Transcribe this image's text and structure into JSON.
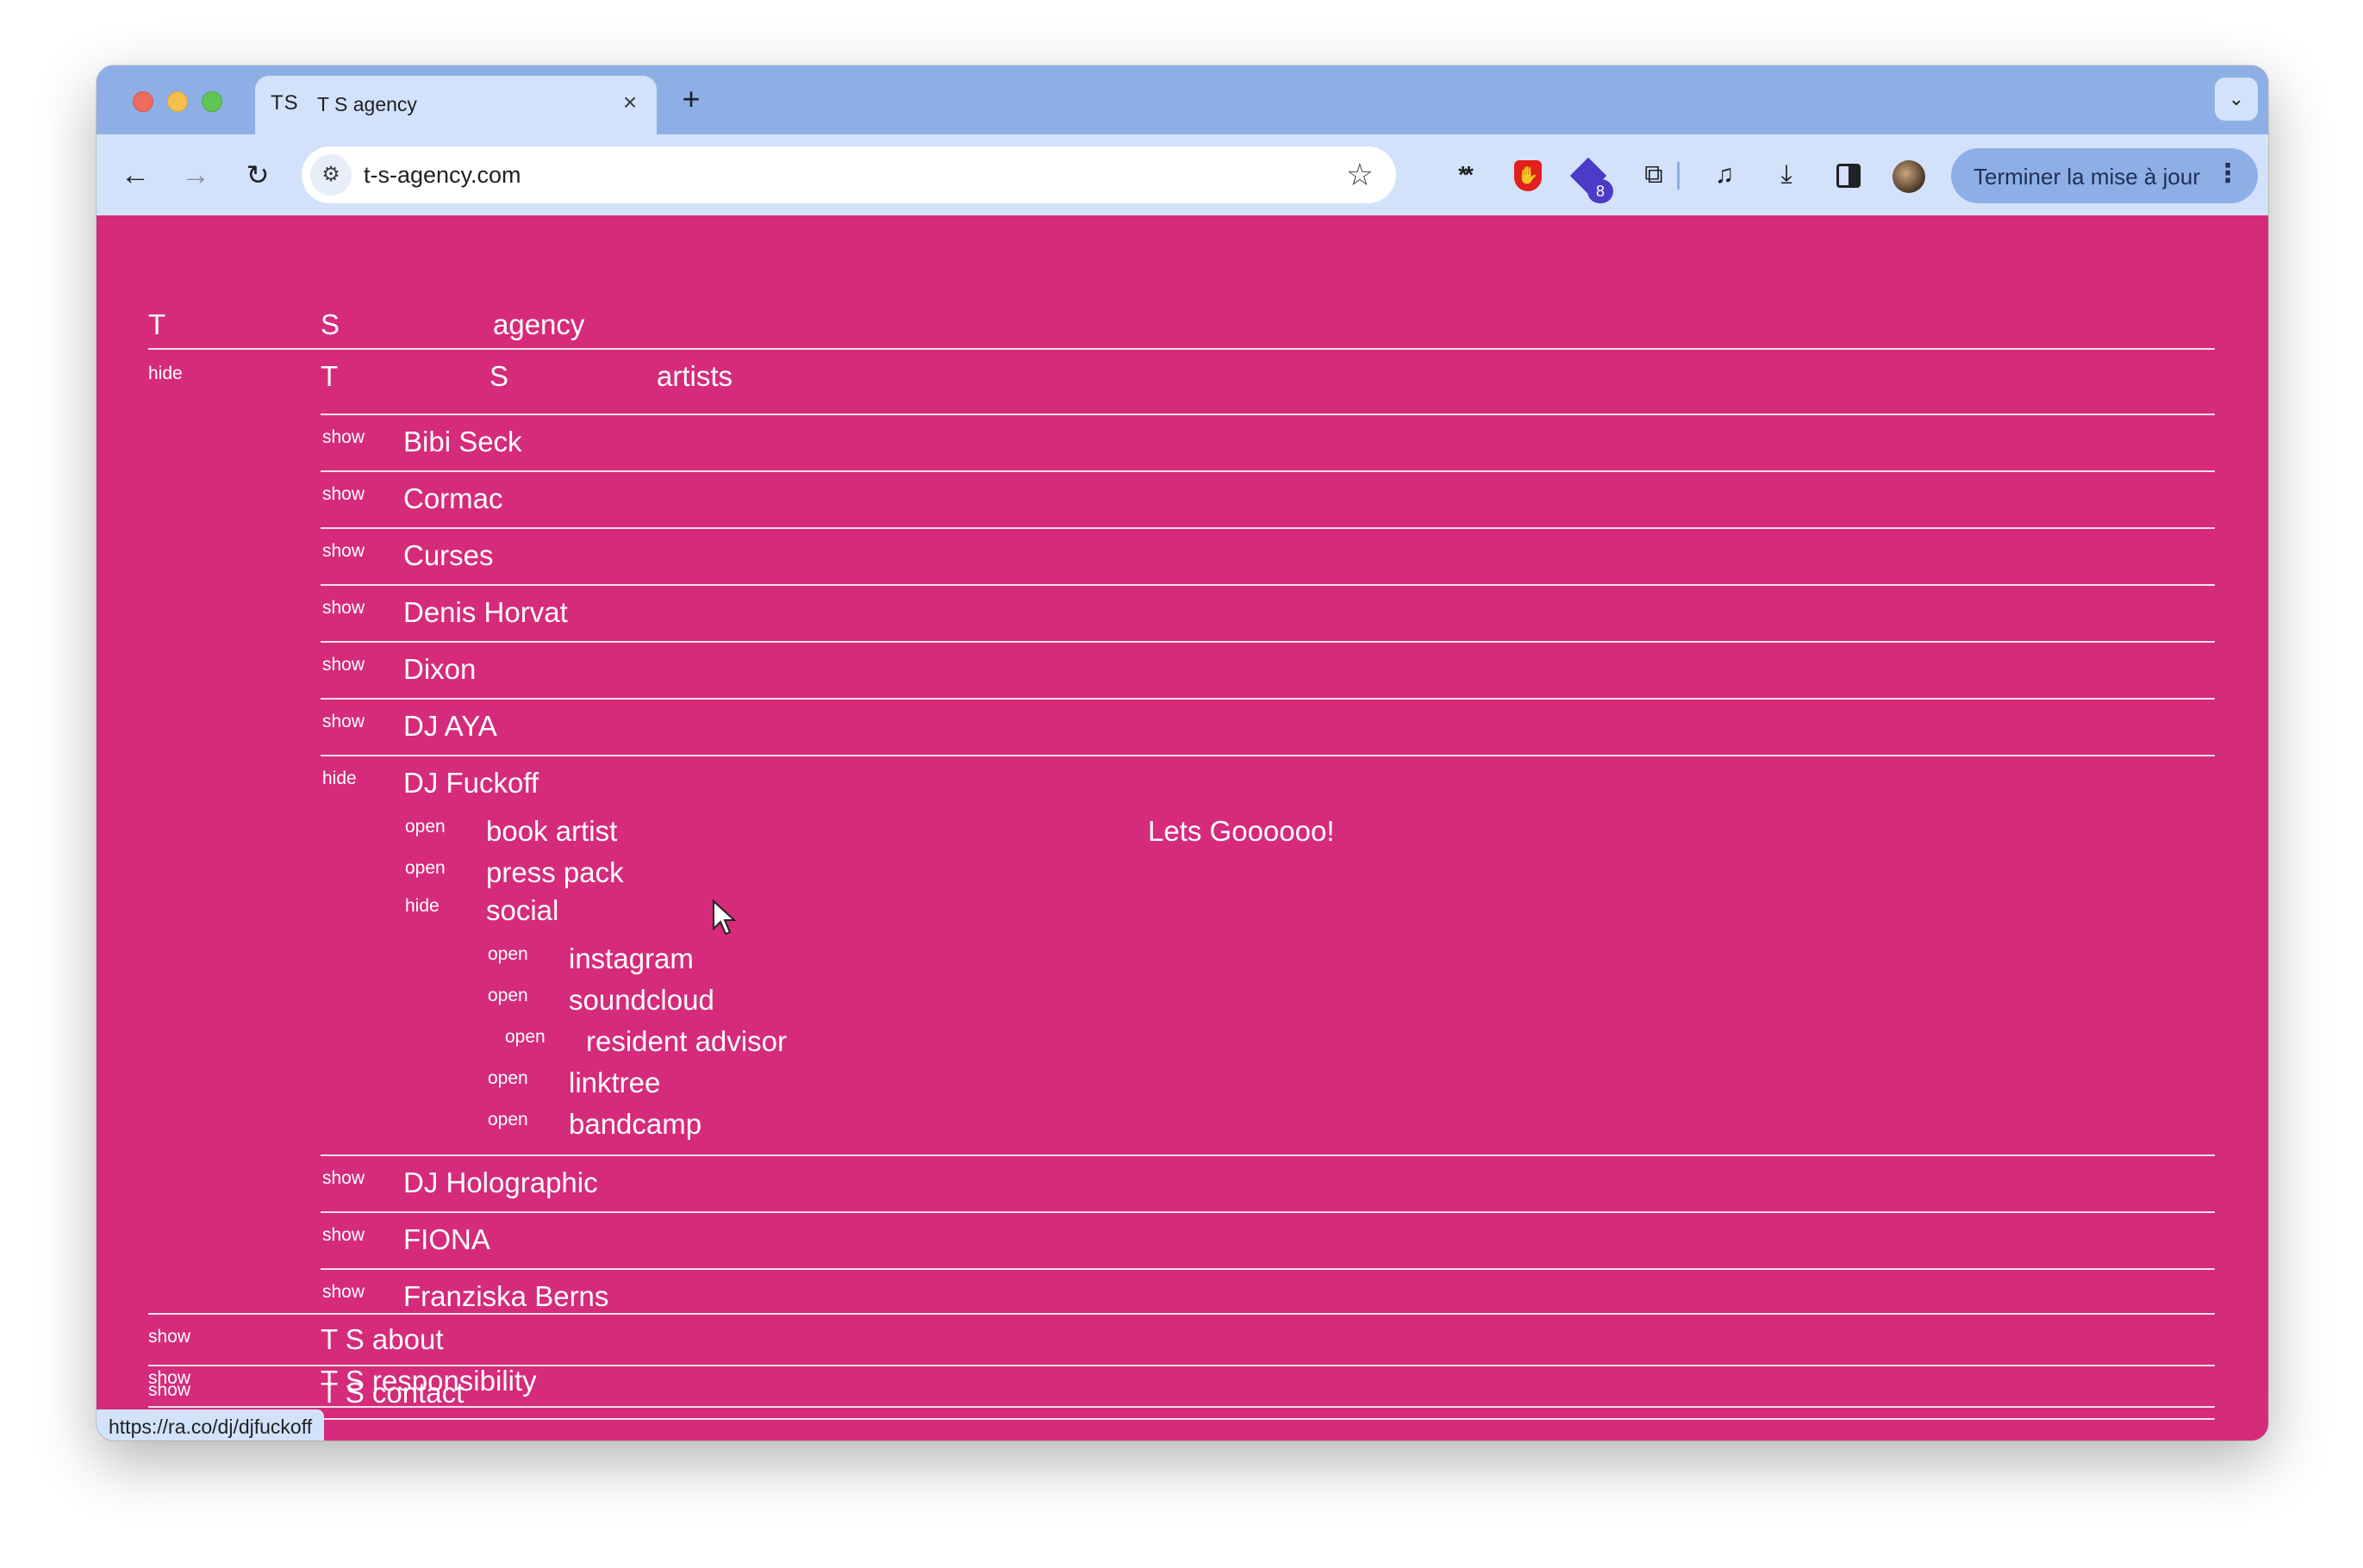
{
  "browser": {
    "tab": {
      "favicon_text": "TS",
      "title": "T S agency",
      "close_icon": "×"
    },
    "new_tab_icon": "+",
    "tab_search_icon": "⌄",
    "nav": {
      "back": "←",
      "forward": "→",
      "reload": "↻"
    },
    "omnibox": {
      "site_info_icon": "⚙",
      "url": "t-s-agency.com",
      "bookmark_icon": "☆"
    },
    "extensions": {
      "asterisk_icon": "**",
      "ublock_icon": "✋",
      "badge_count": "8",
      "puzzle_icon": "⧉"
    },
    "toolbar_icons": {
      "media": "♫",
      "download": "⤓"
    },
    "update_button": {
      "label": "Terminer la mise à jour",
      "menu_icon": "⋮"
    },
    "status_url": "https://ra.co/dj/djfuckoff"
  },
  "site": {
    "header": {
      "col1": "T",
      "col2": "S",
      "col3": "agency"
    },
    "artists_section": {
      "toggle": "hide",
      "col1": "T",
      "col2": "S",
      "col3": "artists",
      "artists": [
        {
          "toggle": "show",
          "name": "Bibi Seck"
        },
        {
          "toggle": "show",
          "name": "Cormac"
        },
        {
          "toggle": "show",
          "name": "Curses"
        },
        {
          "toggle": "show",
          "name": "Denis Horvat"
        },
        {
          "toggle": "show",
          "name": "Dixon"
        },
        {
          "toggle": "show",
          "name": "DJ AYA"
        }
      ],
      "expanded": {
        "toggle": "hide",
        "name": "DJ Fuckoff",
        "book_artist": {
          "toggle": "open",
          "label": "book artist"
        },
        "press_pack": {
          "toggle": "open",
          "label": "press pack"
        },
        "social": {
          "toggle": "hide",
          "label": "social",
          "links": [
            {
              "toggle": "open",
              "label": "instagram"
            },
            {
              "toggle": "open",
              "label": "soundcloud"
            },
            {
              "toggle": "open",
              "label": "resident advisor"
            },
            {
              "toggle": "open",
              "label": "linktree"
            },
            {
              "toggle": "open",
              "label": "bandcamp"
            }
          ]
        },
        "tagline": "Lets Goooooo!"
      },
      "artists_after": [
        {
          "toggle": "show",
          "name": "DJ Holographic"
        },
        {
          "toggle": "show",
          "name": "FIONA"
        },
        {
          "toggle": "show",
          "name": "Franziska Berns"
        }
      ]
    },
    "sections": [
      {
        "toggle": "show",
        "label": "T S about"
      },
      {
        "toggle": "show",
        "label": "T S contact"
      },
      {
        "toggle": "show",
        "label": "T S responsibility"
      }
    ]
  },
  "colors": {
    "page_bg": "#d52b7a",
    "text": "#ffffff",
    "chrome_frame": "#8eafe6",
    "chrome_toolbar": "#d3e2fb"
  }
}
